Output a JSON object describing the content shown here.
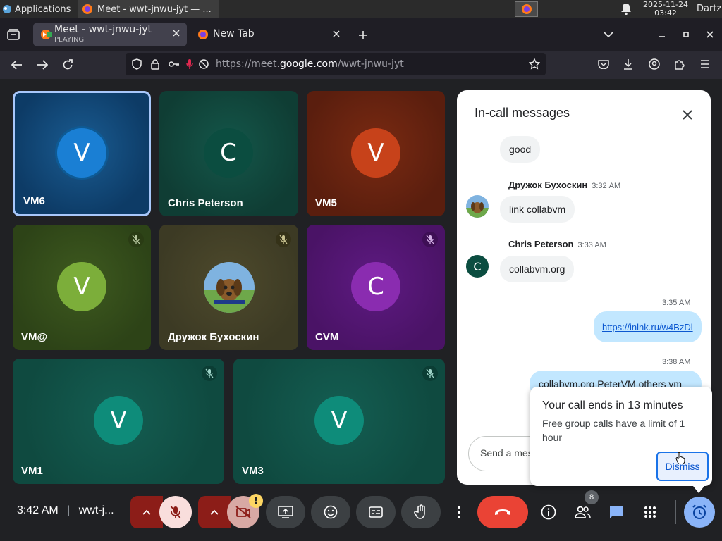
{
  "taskbar": {
    "applications_label": "Applications",
    "task_title": "Meet - wwt-jnwu-jyt — ...",
    "clock_date": "2025-11-24",
    "clock_time": "03:42",
    "user": "Dartz"
  },
  "browser": {
    "tabs": [
      {
        "title": "Meet - wwt-jnwu-jyt",
        "subtitle": "PLAYING"
      },
      {
        "title": "New Tab"
      }
    ],
    "url_prefix": "https://meet.",
    "url_host": "google.com",
    "url_path": "/wwt-jnwu-jyt"
  },
  "participants": [
    {
      "name": "VM6",
      "initial": "V",
      "muted": false,
      "speaking": true,
      "bg": "#0d3b66",
      "avatar_color": "#1a7fd4"
    },
    {
      "name": "Chris Peterson",
      "initial": "C",
      "muted": false,
      "bg": "#0f3d34",
      "avatar_color": "#0b4d40"
    },
    {
      "name": "VM5",
      "initial": "V",
      "muted": false,
      "bg": "#5a1e0e",
      "avatar_color": "#c7421a"
    },
    {
      "name": "VM@",
      "initial": "V",
      "muted": true,
      "bg": "#2d4317",
      "avatar_color": "#7cae3a"
    },
    {
      "name": "Дружок Бухоскин",
      "initial": "",
      "muted": true,
      "bg": "#3c3a24",
      "avatar_color": "#8fbf5a"
    },
    {
      "name": "CVM",
      "initial": "C",
      "muted": true,
      "bg": "#4a1366",
      "avatar_color": "#8a2cb0"
    },
    {
      "name": "VM1",
      "initial": "V",
      "muted": true,
      "bg": "#0f4a40",
      "avatar_color": "#0e8c7a"
    },
    {
      "name": "VM3",
      "initial": "V",
      "muted": true,
      "bg": "#0f4a40",
      "avatar_color": "#0e8c7a"
    }
  ],
  "chat": {
    "title": "In-call messages",
    "messages": [
      {
        "text": "good"
      },
      {
        "sender": "Дружок Бухоскин",
        "time": "3:32 AM",
        "text": "link collabvm"
      },
      {
        "sender": "Chris Peterson",
        "initial": "C",
        "time": "3:33 AM",
        "text": "collabvm.org"
      },
      {
        "time": "3:35 AM",
        "text": "https://inlnk.ru/w4BzDl"
      },
      {
        "time": "3:38 AM",
        "text": "collabvm.org PeterVM others vm"
      }
    ],
    "input_placeholder": "Send a message"
  },
  "popup": {
    "title": "Your call ends in 13 minutes",
    "body": "Free group calls have a limit of 1 hour",
    "dismiss_label": "Dismiss"
  },
  "bottom": {
    "time": "3:42 AM",
    "meeting_code": "wwt-j...",
    "people_count": "8",
    "camera_warning": "!"
  },
  "colors": {
    "accent": "#1a73e8",
    "leave": "#ea4335",
    "mute_red": "#8c1d18",
    "muted_pink": "#f9dedc"
  }
}
